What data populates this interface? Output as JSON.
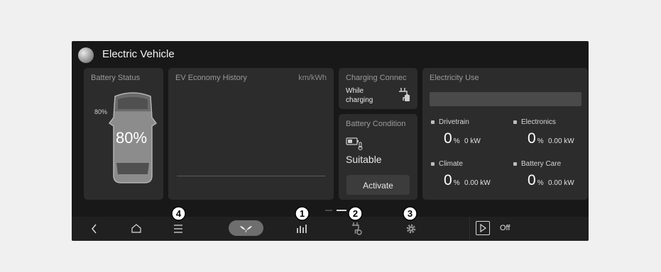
{
  "header": {
    "title": "Electric Vehicle"
  },
  "battery_status": {
    "title": "Battery Status",
    "charge_limit_label": "80%",
    "charge_percent": "80",
    "percent_sign": "%",
    "fill_fraction": 0.8
  },
  "ev_economy": {
    "title": "EV Economy History",
    "unit": "km/kWh"
  },
  "charging_connector": {
    "title": "Charging Connec",
    "status_line1": "While",
    "status_line2": "charging"
  },
  "battery_condition": {
    "title": "Battery Condition",
    "status": "Suitable",
    "activate_label": "Activate"
  },
  "electricity_use": {
    "title": "Electricity Use",
    "items": [
      {
        "label": "Drivetrain",
        "percent": "0",
        "percent_sign": "%",
        "power": "0 kW"
      },
      {
        "label": "Electronics",
        "percent": "0",
        "percent_sign": "%",
        "power": "0.00 kW"
      },
      {
        "label": "Climate",
        "percent": "0",
        "percent_sign": "%",
        "power": "0.00 kW"
      },
      {
        "label": "Battery Care",
        "percent": "0",
        "percent_sign": "%",
        "power": "0.00 kW"
      }
    ]
  },
  "navbar": {
    "icons": [
      "back-icon",
      "home-icon",
      "menu-icon",
      "leaf-icon",
      "bar-chart-icon",
      "charging-settings-icon",
      "gear-icon",
      "play-icon"
    ],
    "media_status": "Off"
  },
  "callouts": [
    "1",
    "2",
    "3",
    "4"
  ]
}
